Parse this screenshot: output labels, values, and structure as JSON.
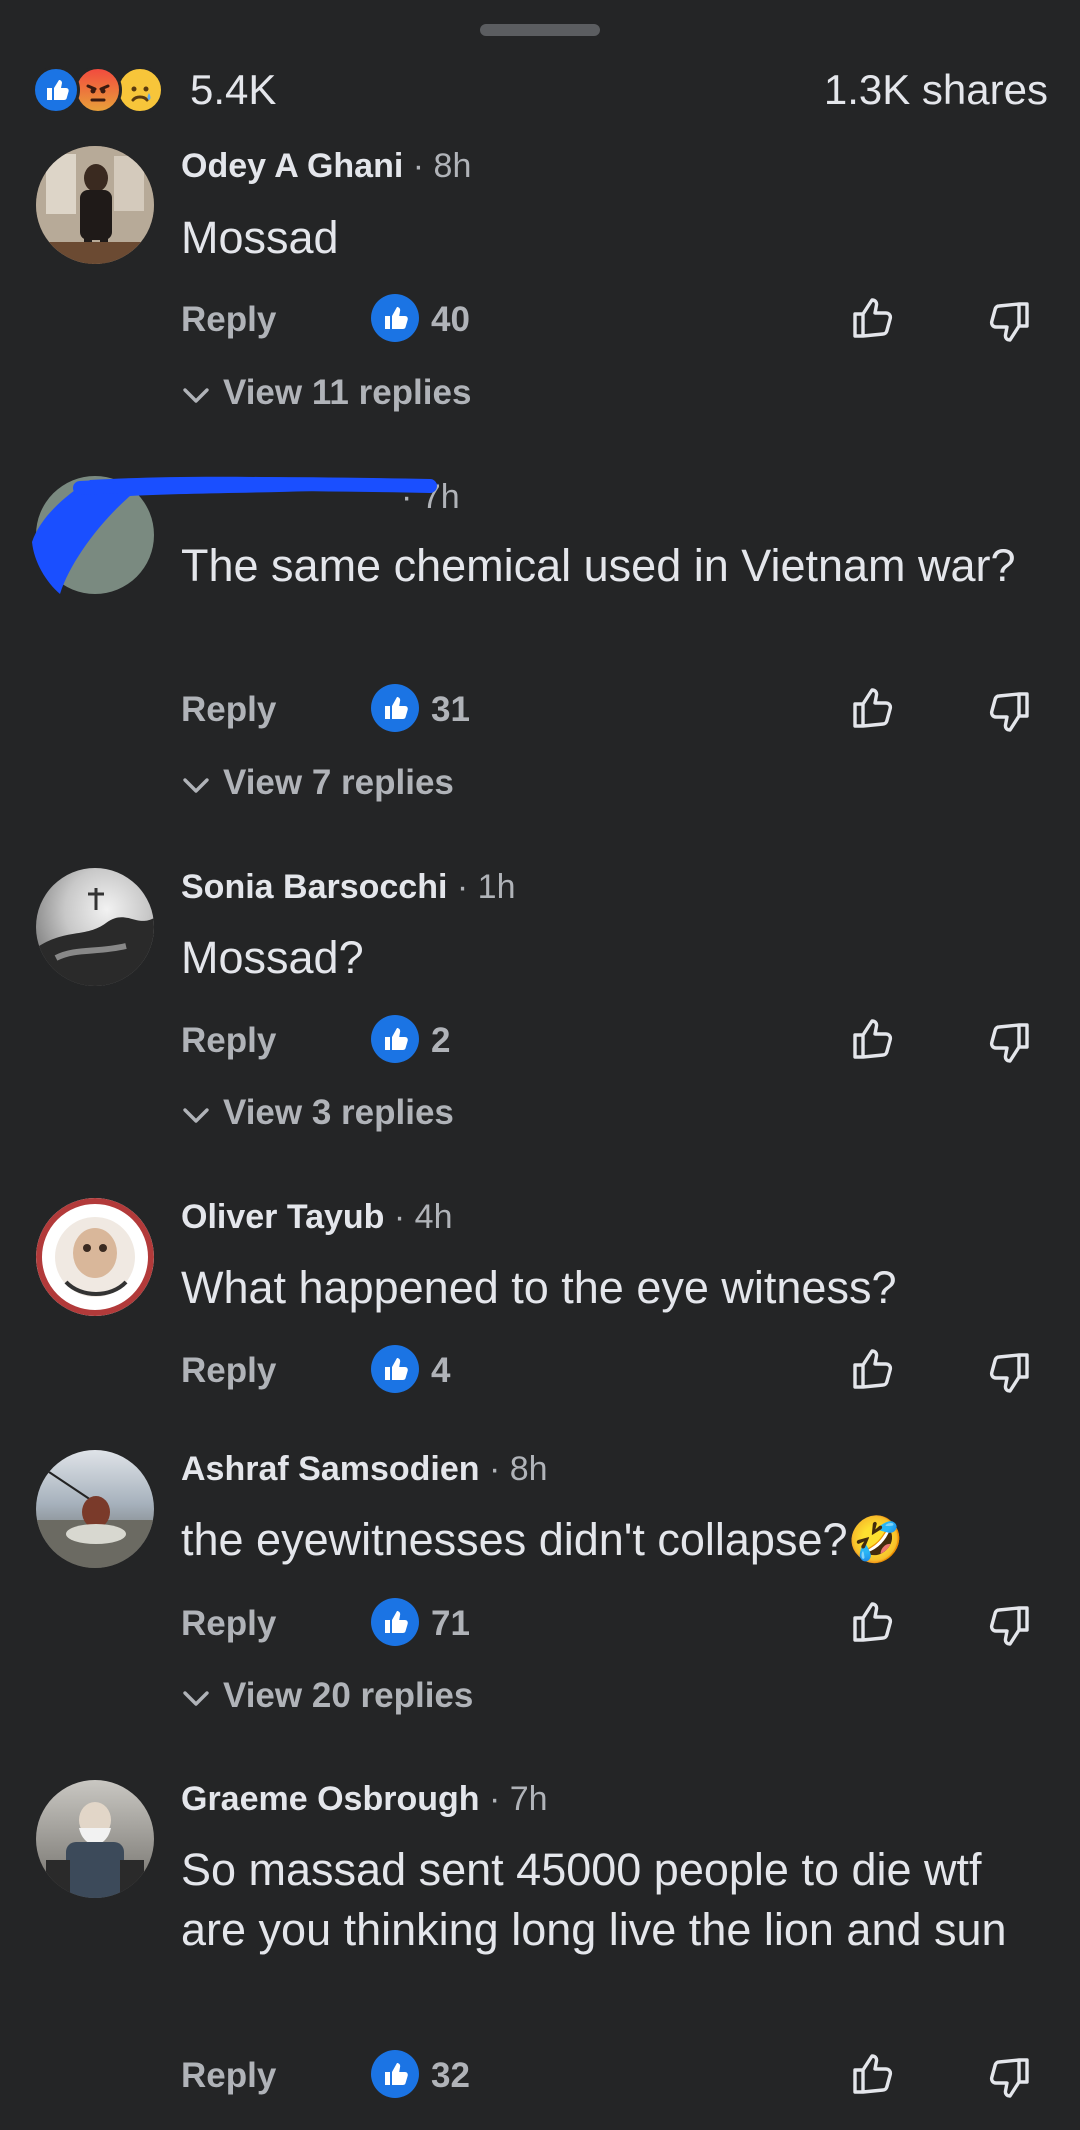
{
  "summary": {
    "reaction_icons": [
      "like-reaction",
      "angry-reaction",
      "sad-reaction"
    ],
    "reaction_count": "5.4K",
    "shares": "1.3K shares"
  },
  "comments": [
    {
      "author": "Odey A Ghani",
      "time": "8h",
      "text": "Mossad",
      "reply_label": "Reply",
      "likes": "40",
      "view_replies": "View 11 replies"
    },
    {
      "author": "",
      "time": "7h",
      "text": "The same chemical used in Vietnam war?",
      "reply_label": "Reply",
      "likes": "31",
      "view_replies": "View 7 replies"
    },
    {
      "author": "Sonia Barsocchi",
      "time": "1h",
      "text": "Mossad?",
      "reply_label": "Reply",
      "likes": "2",
      "view_replies": "View 3 replies"
    },
    {
      "author": "Oliver Tayub",
      "time": "4h",
      "text": "What happened to the eye witness?",
      "reply_label": "Reply",
      "likes": "4"
    },
    {
      "author": "Ashraf Samsodien",
      "time": "8h",
      "text": "the eyewitnesses didn't collapse?🤣",
      "reply_label": "Reply",
      "likes": "71",
      "view_replies": "View 20 replies"
    },
    {
      "author": "Graeme Osbrough",
      "time": "7h",
      "text": "So massad sent 45000 people to die wtf are you thinking long live the lion and sun",
      "reply_label": "Reply",
      "likes": "32"
    }
  ],
  "colors": {
    "background": "#242526",
    "primary_text": "#e4e6eb",
    "secondary_text": "#b0b3b8",
    "like_blue": "#1b74e4",
    "redaction": "#1a4fff"
  }
}
